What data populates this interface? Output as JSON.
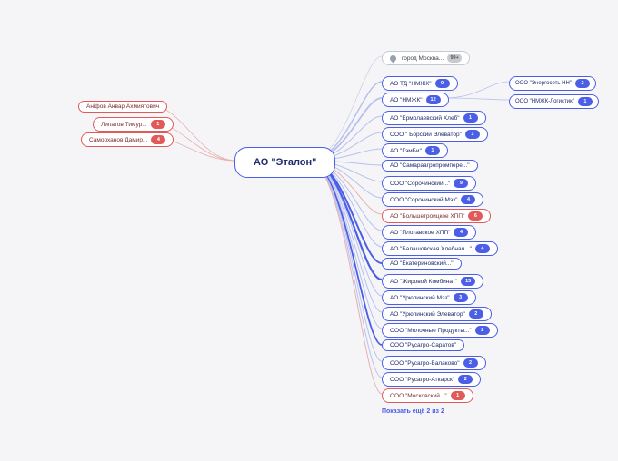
{
  "center": {
    "label": "АО \"Эталон\""
  },
  "location": {
    "label": "город Москва...",
    "badge": "99+"
  },
  "left": [
    {
      "label": "Аніфов Анвар Ахмиятович",
      "badge": ""
    },
    {
      "label": "Липатов Тимур...",
      "badge": "1"
    },
    {
      "label": "Саморханов Дамир...",
      "badge": "4"
    }
  ],
  "right": [
    {
      "label": "АО ТД \"НМЖК\"",
      "badge": "9",
      "color": "blue"
    },
    {
      "label": "АО \"НМЖК\"",
      "badge": "12",
      "color": "blue",
      "sub": [
        {
          "label": "ООО \"Энергосеть НН\"",
          "badge": "2"
        },
        {
          "label": "ООО \"НМЖК-Логистик\"",
          "badge": "1"
        }
      ]
    },
    {
      "label": "АО \"Ермолаевский Хлеб\"",
      "badge": "1",
      "color": "blue"
    },
    {
      "label": "ООО \" Борский Элеватор\"",
      "badge": "1",
      "color": "blue"
    },
    {
      "label": "АО \"ГэмБи\"",
      "badge": "1",
      "color": "blue"
    },
    {
      "label": "АО \"Самараагропромпере...\"",
      "badge": "",
      "color": "blue"
    },
    {
      "label": "ООО \"Сорочинский...\"",
      "badge": "9",
      "color": "blue"
    },
    {
      "label": "ООО \"Сорочинский Мэз\"",
      "badge": "4",
      "color": "blue"
    },
    {
      "label": "АО \"Большетроицкое ХПП\"",
      "badge": "6",
      "color": "red"
    },
    {
      "label": "АО \"Плотавское ХПП\"",
      "badge": "4",
      "color": "blue"
    },
    {
      "label": "АО \"Балашовская Хлебная...\"",
      "badge": "4",
      "color": "blue"
    },
    {
      "label": "АО \"Екатериновский...\"",
      "badge": "",
      "color": "blue"
    },
    {
      "label": "АО \"Жировой Комбинат\"",
      "badge": "15",
      "color": "blue"
    },
    {
      "label": "АО \"Урюпинский Мэз\"",
      "badge": "3",
      "color": "blue"
    },
    {
      "label": "АО \"Урюпинский Элеватор\"",
      "badge": "2",
      "color": "blue"
    },
    {
      "label": "ООО \"Молочные Продукты...\"",
      "badge": "2",
      "color": "blue"
    },
    {
      "label": "ООО \"Русагро-Саратов\"",
      "badge": "",
      "color": "blue"
    },
    {
      "label": "ООО \"Русагро-Балаково\"",
      "badge": "2",
      "color": "blue"
    },
    {
      "label": "ООО \"Русагро-Аткарск\"",
      "badge": "2",
      "color": "blue"
    },
    {
      "label": "ООО \"Московский...\"",
      "badge": "1",
      "color": "red"
    }
  ],
  "moreLink": {
    "label": "Показать ещё 2 из 2"
  }
}
